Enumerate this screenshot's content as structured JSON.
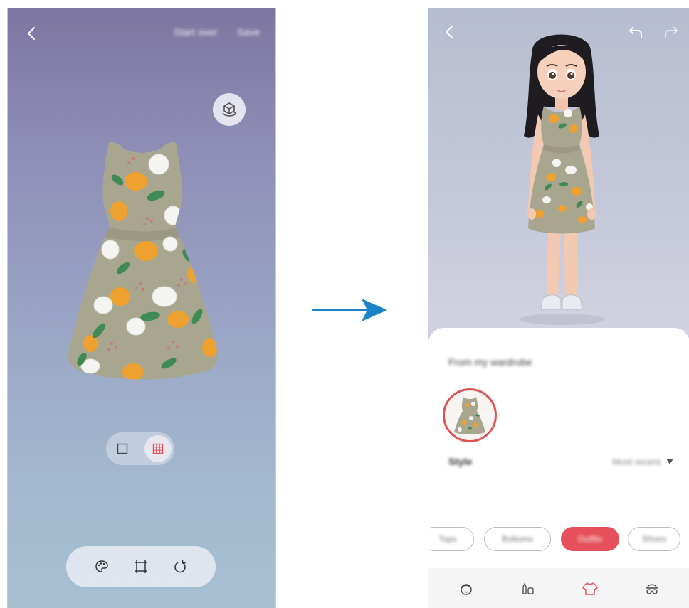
{
  "left_screen": {
    "topbar": {
      "start_over_label": "Start over",
      "save_label": "Save"
    },
    "view_toggle": {
      "selected": "grid"
    },
    "tools": [
      "palette-icon",
      "crop-icon",
      "rotate-icon"
    ]
  },
  "right_screen": {
    "panel": {
      "title": "From my wardrobe",
      "style_label": "Style",
      "style_value": "Most recent"
    },
    "categories": [
      {
        "label": "Tops",
        "active": false
      },
      {
        "label": "Bottoms",
        "active": false
      },
      {
        "label": "Outfits",
        "active": true
      },
      {
        "label": "Shoes",
        "active": false
      }
    ],
    "nav_icons": [
      "face-icon",
      "makeup-icon",
      "clothing-icon",
      "accessory-icon"
    ]
  },
  "colors": {
    "accent": "#e5505a",
    "arrow": "#1b83c8",
    "dress_base": "#a9a690",
    "flower_orange": "#eea12e",
    "flower_white": "#f4f4f1",
    "leaf_green": "#3f8a55"
  }
}
